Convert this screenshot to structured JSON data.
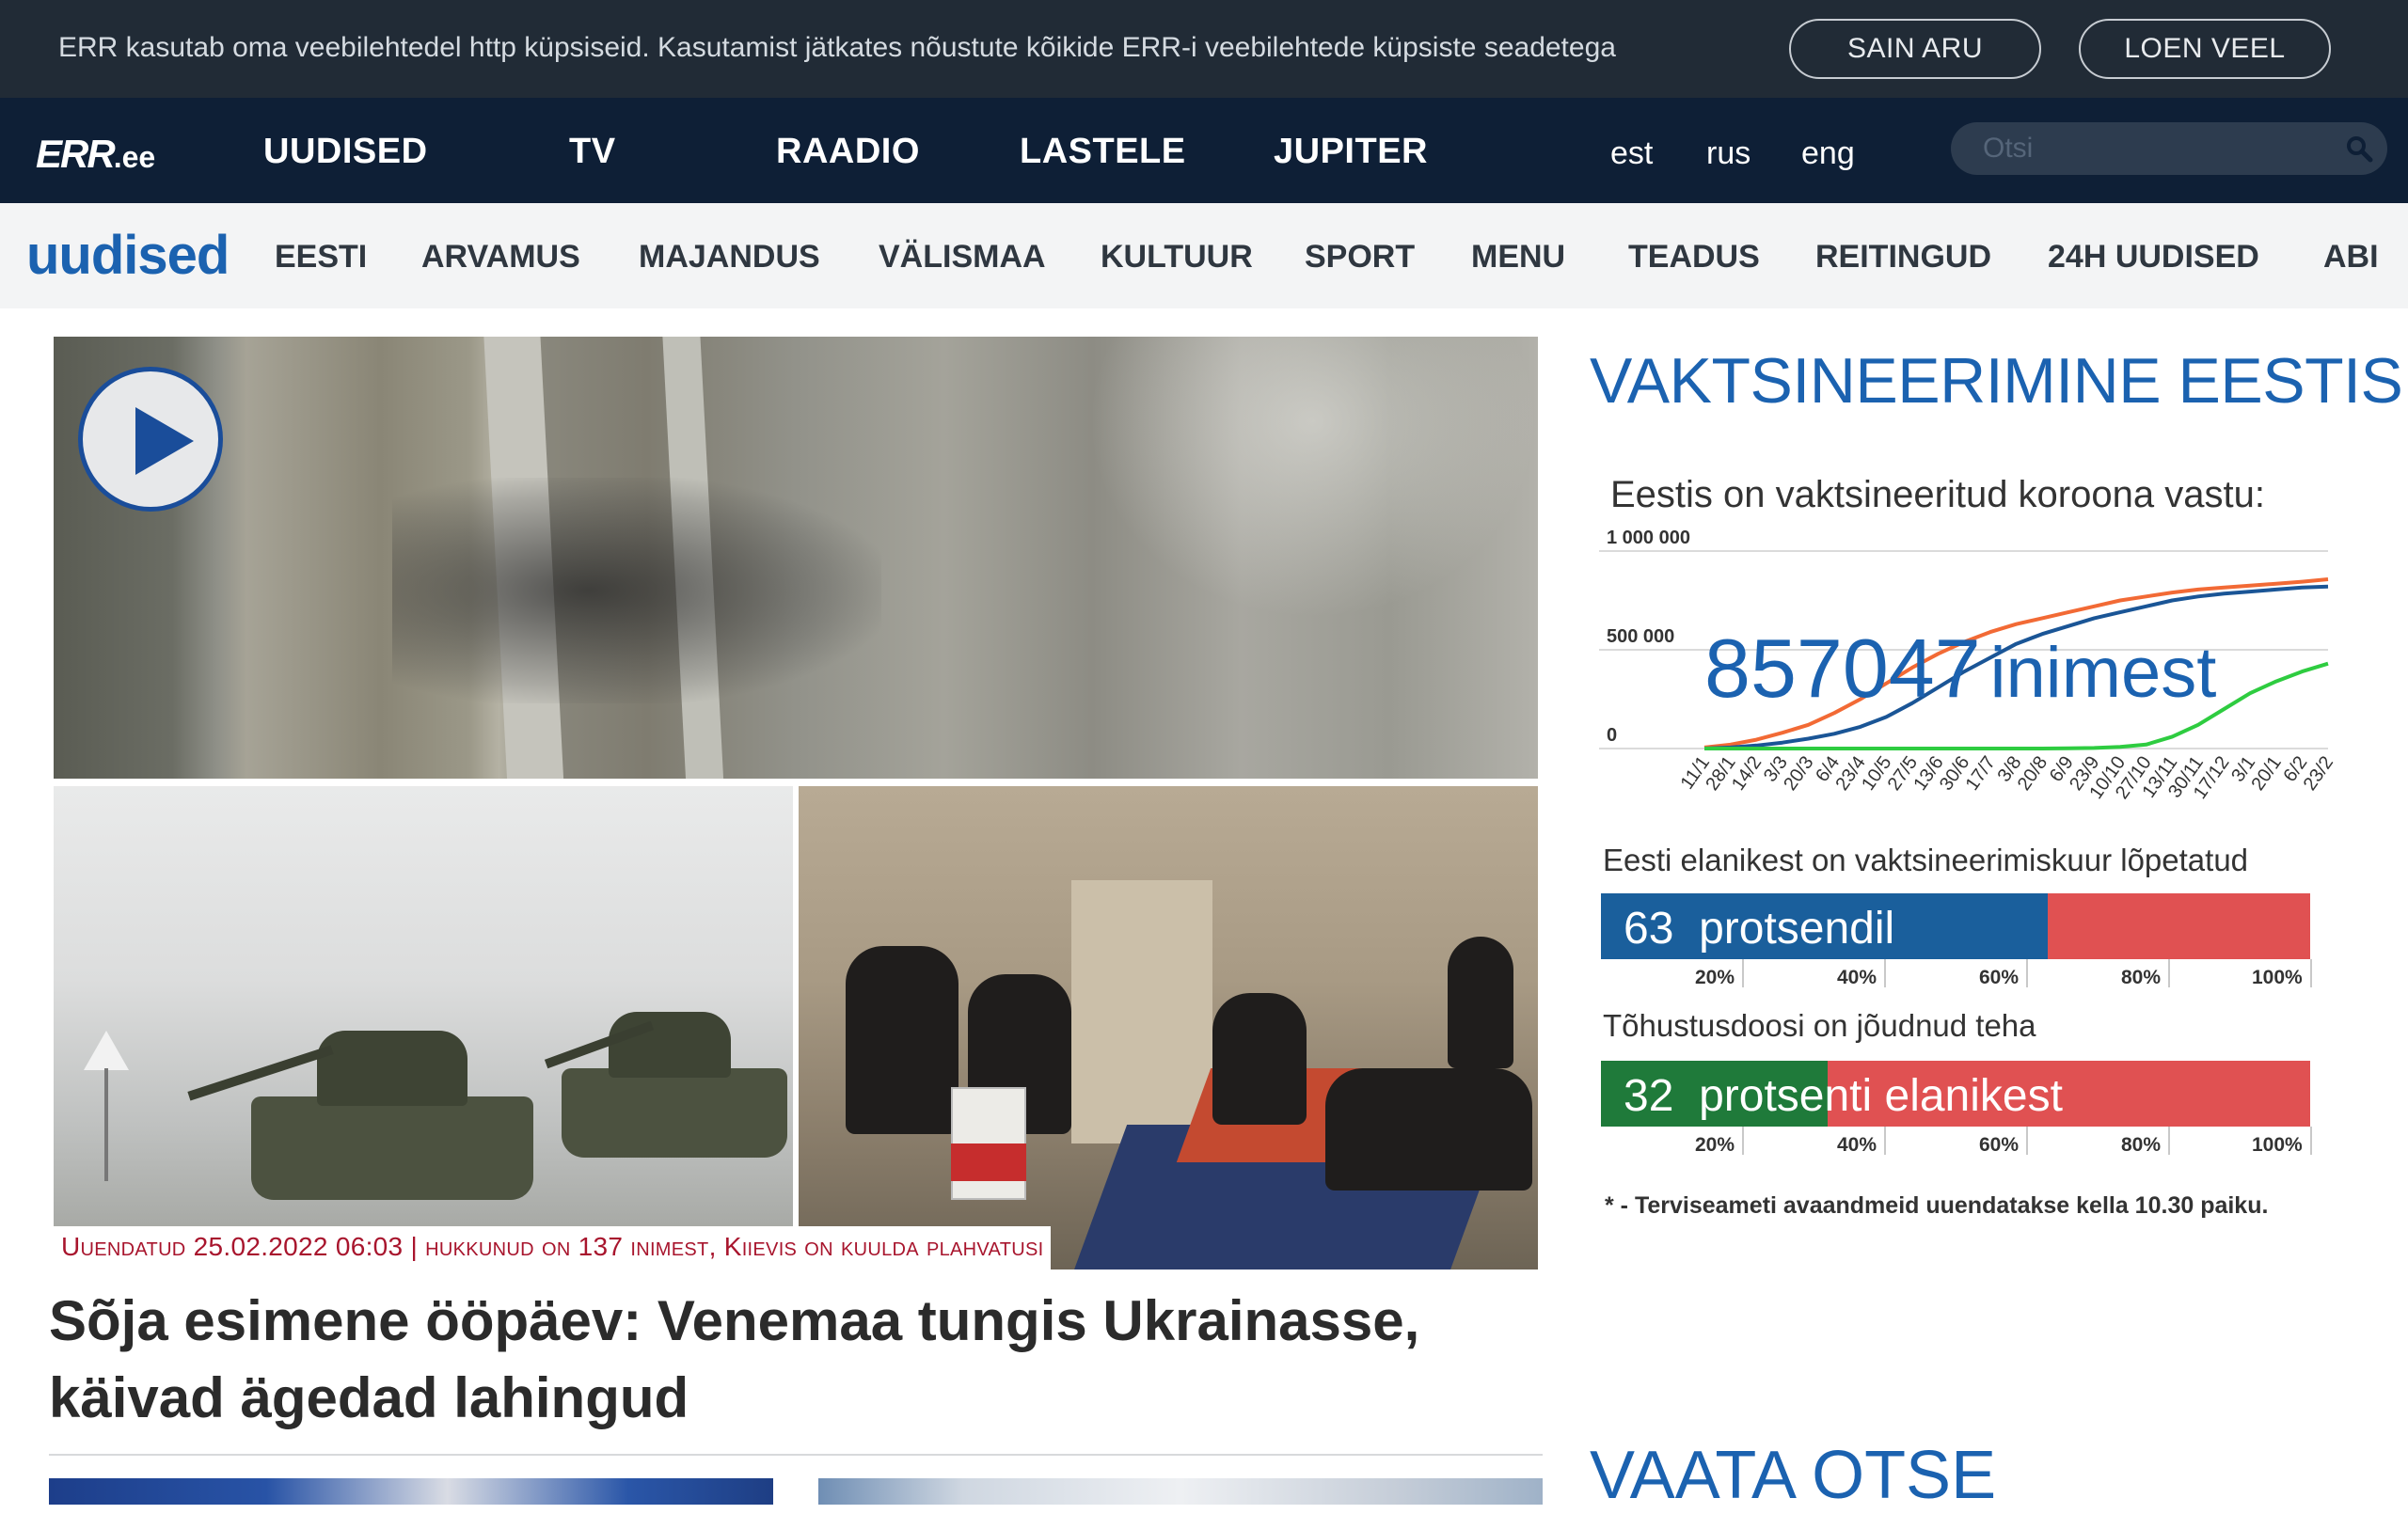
{
  "cookie_bar": {
    "text": "ERR kasutab oma veebilehtedel http küpsiseid. Kasutamist jätkates nõustute kõikide ERR-i veebilehtede küpsiste seadetega",
    "accept_label": "SAIN ARU",
    "more_label": "LOEN VEEL"
  },
  "main_nav": {
    "logo_main": "ERR",
    "logo_suffix": ".ee",
    "items": [
      "UUDISED",
      "TV",
      "RAADIO",
      "LASTELE",
      "JUPITER"
    ],
    "languages": [
      "est",
      "rus",
      "eng"
    ],
    "search_placeholder": "Otsi"
  },
  "sub_nav": {
    "section_title": "uudised",
    "items": [
      "EESTI",
      "ARVAMUS",
      "MAJANDUS",
      "VÄLISMAA",
      "KULTUUR",
      "SPORT",
      "MENU",
      "TEADUS",
      "REITINGUD",
      "24H UUDISED",
      "ABI"
    ]
  },
  "hero": {
    "caption_prefix": "Uuendatud 25.02.2022 06:03 | ",
    "caption_rest": "hukkunud on 137 inimest, Kiievis on kuulda plahvatusi",
    "headline": "Sõja esimene ööpäev: Venemaa tungis Ukrainasse, käivad ägedad lahingud"
  },
  "vaccination": {
    "title": "VAKTSINEERIMINE EESTIS",
    "subtitle": "Eestis on vaktsineeritud koroona vastu:",
    "count_value": "857047",
    "count_unit": "inimest",
    "bar1_label": "Eesti elanikest on vaktsineerimiskuur lõpetatud",
    "bar1_value": "63",
    "bar1_unit": "protsendil",
    "bar1_percent": 63,
    "bar1_color": "#1a5f9c",
    "bar2_label": "Tõhustusdoosi on jõudnud teha",
    "bar2_value": "32",
    "bar2_unit": "protsenti elanikest",
    "bar2_percent": 32,
    "bar2_color": "#1f7a3a",
    "bar_remainder_color": "#e05152",
    "bar_ticks": [
      "20%",
      "40%",
      "60%",
      "80%",
      "100%"
    ],
    "note": "* - Terviseameti avaandmeid uuendatakse kella 10.30 paiku."
  },
  "live": {
    "title": "VAATA OTSE"
  },
  "chart_data": {
    "type": "line",
    "ylim": [
      0,
      1000000
    ],
    "y_ticks": [
      "0",
      "500 000",
      "1 000 000"
    ],
    "x": [
      "11/1",
      "28/1",
      "14/2",
      "3/3",
      "20/3",
      "6/4",
      "23/4",
      "10/5",
      "27/5",
      "13/6",
      "30/6",
      "17/7",
      "3/8",
      "20/8",
      "6/9",
      "23/9",
      "10/10",
      "27/10",
      "13/11",
      "30/11",
      "17/12",
      "3/1",
      "20/1",
      "6/2",
      "23/2"
    ],
    "series": [
      {
        "color": "#f26a35",
        "values": [
          5000,
          20000,
          45000,
          80000,
          120000,
          180000,
          250000,
          330000,
          410000,
          480000,
          540000,
          590000,
          630000,
          660000,
          690000,
          720000,
          750000,
          770000,
          790000,
          805000,
          815000,
          825000,
          835000,
          845000,
          857047
        ]
      },
      {
        "color": "#1a5596",
        "values": [
          0,
          5000,
          15000,
          30000,
          50000,
          75000,
          110000,
          160000,
          230000,
          310000,
          390000,
          460000,
          530000,
          580000,
          620000,
          660000,
          690000,
          720000,
          750000,
          770000,
          785000,
          795000,
          805000,
          815000,
          820000
        ]
      },
      {
        "color": "#2ecc40",
        "values": [
          0,
          0,
          0,
          0,
          0,
          0,
          0,
          0,
          0,
          0,
          0,
          0,
          0,
          0,
          1000,
          3000,
          8000,
          20000,
          60000,
          120000,
          200000,
          280000,
          340000,
          390000,
          430000
        ]
      }
    ]
  }
}
